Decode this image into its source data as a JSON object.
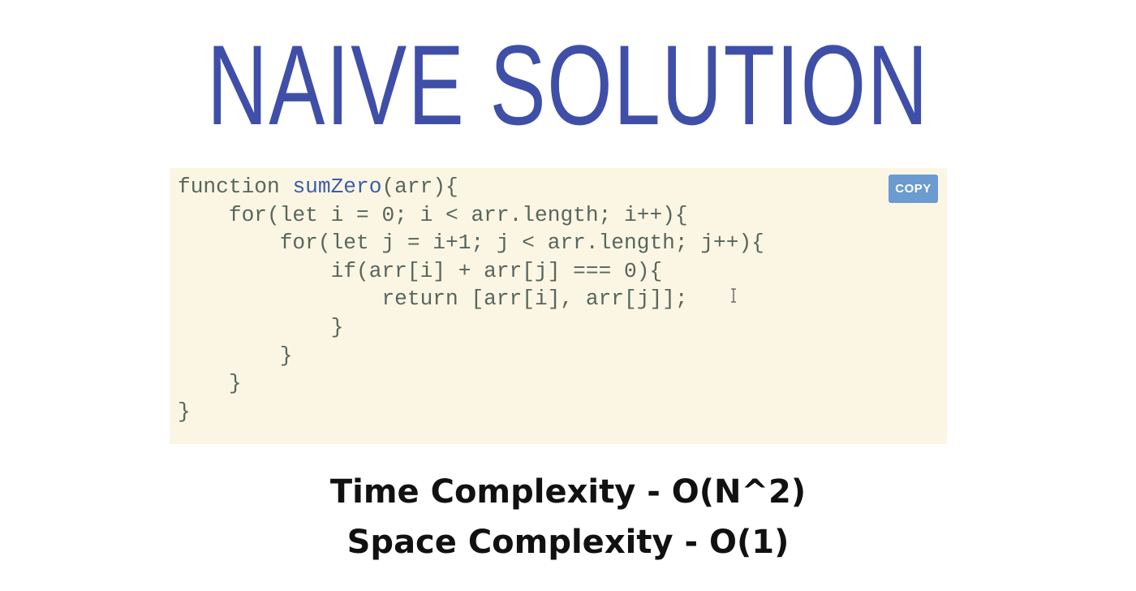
{
  "title": "NAIVE SOLUTION",
  "code_block": {
    "copy_label": "COPY",
    "lines": [
      {
        "pre": "function ",
        "fn": "sumZero",
        "post": "(arr){"
      },
      {
        "pre": "    for(let i = 0; i < arr.length; i++){",
        "fn": "",
        "post": ""
      },
      {
        "pre": "        for(let j = i+1; j < arr.length; j++){",
        "fn": "",
        "post": ""
      },
      {
        "pre": "            if(arr[i] + arr[j] === 0){",
        "fn": "",
        "post": ""
      },
      {
        "pre": "                return [arr[i], arr[j]];",
        "fn": "",
        "post": ""
      },
      {
        "pre": "            }",
        "fn": "",
        "post": ""
      },
      {
        "pre": "        }",
        "fn": "",
        "post": ""
      },
      {
        "pre": "    }",
        "fn": "",
        "post": ""
      },
      {
        "pre": "}",
        "fn": "",
        "post": ""
      }
    ]
  },
  "complexity": {
    "time": "Time Complexity - O(N^2)",
    "space": "Space Complexity - O(1)"
  },
  "colors": {
    "title": "#3f4fa8",
    "code_background": "#fbf6e4",
    "code_text": "#58655d",
    "function_name": "#3b5dab",
    "copy_button": "#6b9bd0"
  },
  "icons": {
    "cursor": "text-cursor-icon"
  }
}
